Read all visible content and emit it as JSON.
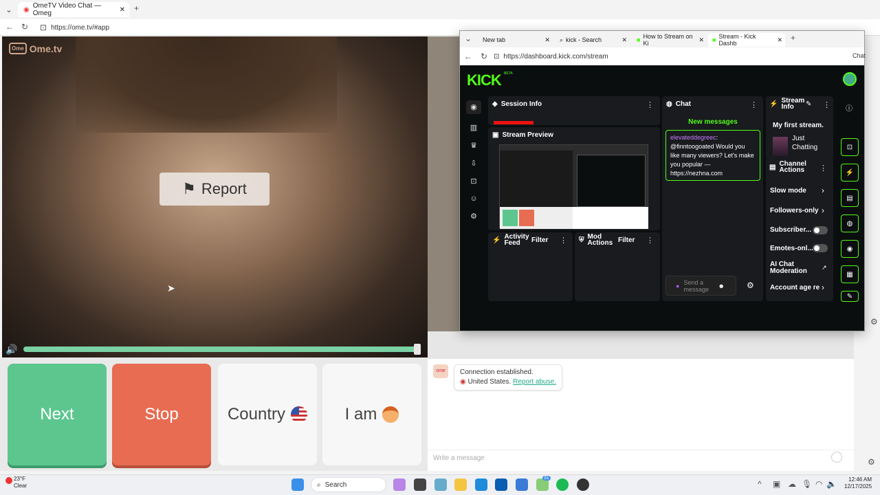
{
  "browser1": {
    "tab_title": "OmeTV Video Chat — Omeg",
    "url": "https://ome.tv/#app",
    "new_tab_symbol": "+"
  },
  "video": {
    "logo_text": "Ome.tv",
    "report_label": "Report",
    "volume_level": 1.0
  },
  "controls": {
    "next": "Next",
    "stop": "Stop",
    "country": "Country",
    "iam": "I am"
  },
  "chat": {
    "connection": "Connection established.",
    "country": "United States.",
    "report_abuse": "Report abuse.",
    "input_placeholder": "Write a message"
  },
  "browser2": {
    "tabs": [
      "New tab",
      "kick - Search",
      "How to Stream on Ki",
      "Stream - Kick Dashb"
    ],
    "url": "https://dashboard.kick.com/stream",
    "chat_label": "Chat"
  },
  "kick": {
    "logo": "KICK",
    "beta": "BETA",
    "session_info": "Session Info",
    "stream_preview": "Stream Preview",
    "activity_feed": "Activity Feed",
    "mod_actions": "Mod Actions",
    "filter": "Filter",
    "chat_title": "Chat",
    "new_messages": "New messages",
    "msg_user": "elevateddegreec",
    "msg_text": "@finntoogoated Would you like many viewers? Let's make you popular — https://nezhna.com",
    "send_placeholder": "Send a message",
    "stream_info": "Stream Info",
    "stream_title": "My first stream.",
    "category": "Just Chatting",
    "channel_actions": "Channel Actions",
    "slow_mode": "Slow mode",
    "followers_only": "Followers-only",
    "subscriber": "Subscriber...",
    "emotes_only": "Emotes-onl...",
    "ai_moderation": "AI Chat Moderation",
    "account_age": "Account age re"
  },
  "taskbar": {
    "temp": "23°F",
    "weather": "Clear",
    "search": "Search",
    "time": "12:46 AM",
    "date": "12/17/2025",
    "badge": "31"
  },
  "colors": {
    "kick_green": "#53fc18",
    "next": "#5cc68e",
    "stop": "#e76c52"
  }
}
